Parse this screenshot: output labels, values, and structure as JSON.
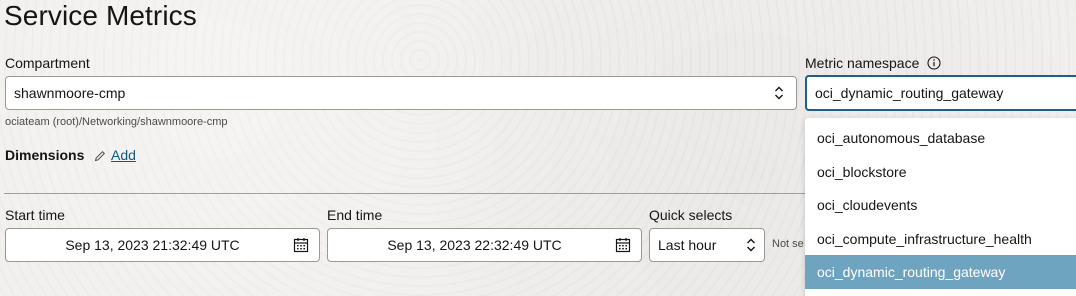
{
  "page": {
    "title": "Service Metrics"
  },
  "compartment": {
    "label": "Compartment",
    "value": "shawnmoore-cmp",
    "path": "ociateam (root)/Networking/shawnmoore-cmp"
  },
  "dimensions": {
    "label": "Dimensions",
    "add_label": "Add"
  },
  "namespace": {
    "label": "Metric namespace",
    "value": "oci_dynamic_routing_gateway",
    "options": [
      "oci_autonomous_database",
      "oci_blockstore",
      "oci_cloudevents",
      "oci_compute_infrastructure_health",
      "oci_dynamic_routing_gateway"
    ],
    "selected_index": 4
  },
  "start_time": {
    "label": "Start time",
    "value": "Sep 13, 2023 21:32:49 UTC"
  },
  "end_time": {
    "label": "End time",
    "value": "Sep 13, 2023 22:32:49 UTC"
  },
  "quick_selects": {
    "label": "Quick selects",
    "value": "Last hour"
  },
  "truncated_text": "Not se",
  "colors": {
    "selected_option": "#6ea4bf",
    "link": "#0e5a84"
  }
}
